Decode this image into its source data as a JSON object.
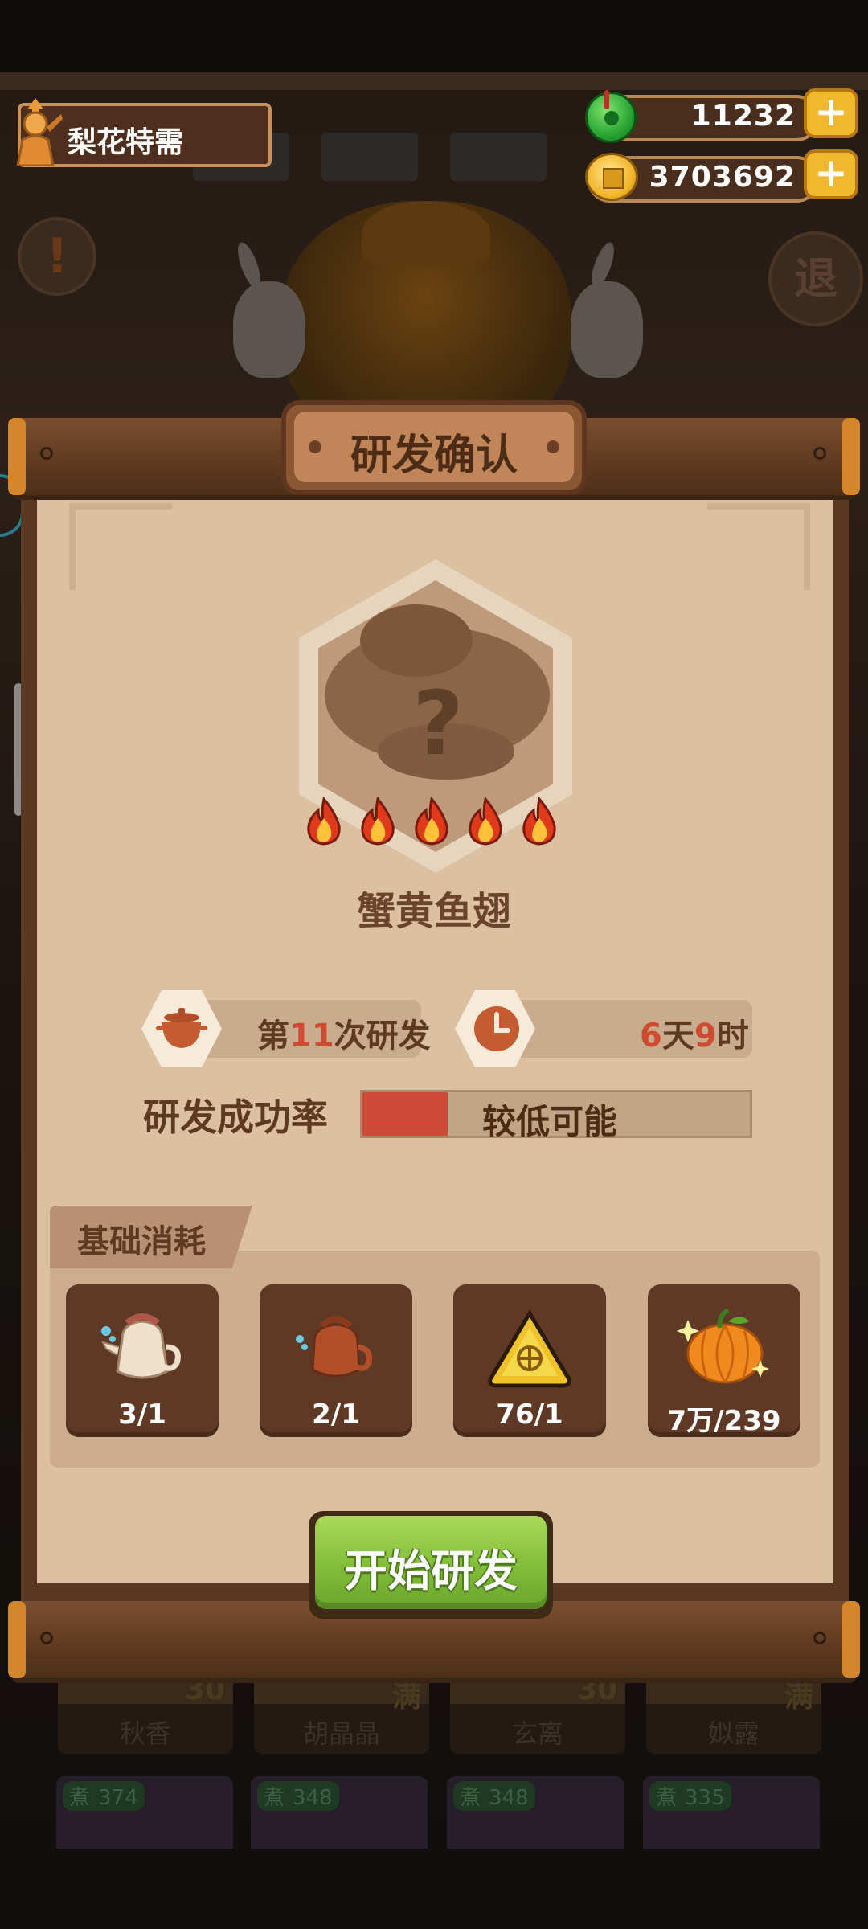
{
  "header": {
    "player_name": "梨花特需",
    "jade_amount": "11232",
    "coin_amount": "3703692",
    "plus_label": "+"
  },
  "background": {
    "retreat_button": "退",
    "alert_symbol": "!",
    "chef_cards": [
      {
        "level": "30",
        "name": "秋香"
      },
      {
        "level": "满",
        "name": "胡晶晶"
      },
      {
        "level": "30",
        "name": "玄离"
      },
      {
        "level": "满",
        "name": "姒露"
      }
    ],
    "bottom_cards": [
      {
        "tag": "煮",
        "value": "374"
      },
      {
        "tag": "煮",
        "value": "348"
      },
      {
        "tag": "煮",
        "value": "348"
      },
      {
        "tag": "煮",
        "value": "335"
      }
    ]
  },
  "dialog": {
    "title": "研发确认",
    "dish_name": "蟹黄鱼翅",
    "unknown_mark": "?",
    "flame_count": 5,
    "attempt": {
      "prefix": "第",
      "number": "11",
      "suffix": "次研发"
    },
    "time": {
      "days": "6",
      "days_unit": "天",
      "hours": "9",
      "hours_unit": "时"
    },
    "success_rate": {
      "label": "研发成功率",
      "text": "较低可能",
      "fill": 0.22
    },
    "cost_section": {
      "title": "基础消耗",
      "items": [
        {
          "icon": "white-teapot-icon",
          "qty": "3/1"
        },
        {
          "icon": "clay-teapot-icon",
          "qty": "2/1"
        },
        {
          "icon": "gold-triangle-token-icon",
          "qty": "76/1"
        },
        {
          "icon": "pumpkin-icon",
          "qty": "7万/239"
        }
      ]
    },
    "start_button": "开始研发"
  },
  "colors": {
    "paper": "#dbc0a2",
    "wood": "#6b4227",
    "accent_red": "#cf4938",
    "button_green": "#82bd39",
    "gold": "#f2b82d"
  }
}
